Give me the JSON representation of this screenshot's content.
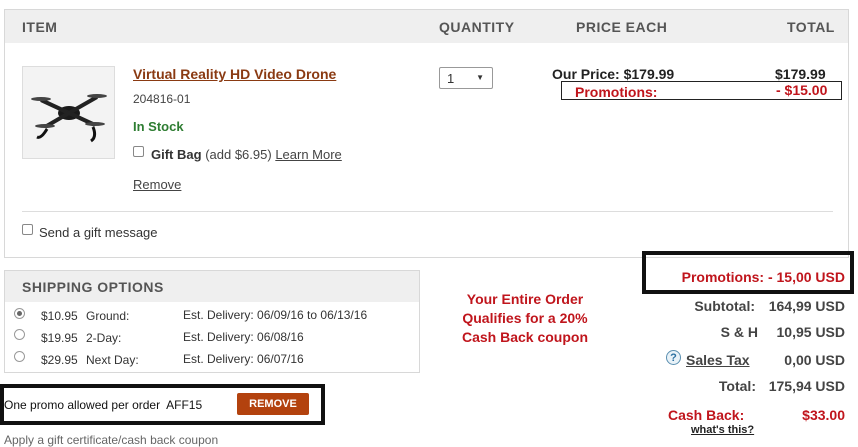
{
  "cart": {
    "headers": {
      "item": "ITEM",
      "quantity": "QUANTITY",
      "price_each": "PRICE EACH",
      "total": "TOTAL"
    },
    "item": {
      "name": "Virtual Reality HD Video Drone",
      "sku": "204816-01",
      "stock": "In Stock",
      "gift_bag_label": "Gift Bag",
      "gift_bag_price": "(add $6.95)",
      "learn_more": "Learn More",
      "remove": "Remove",
      "quantity": "1",
      "our_price_label": "Our Price:",
      "our_price": "$179.99",
      "total": "$179.99",
      "promotions_label": "Promotions:",
      "promotions_value": "- $15.00"
    },
    "gift_message_label": "Send a gift message"
  },
  "shipping": {
    "title": "SHIPPING OPTIONS",
    "options": [
      {
        "price": "$10.95",
        "name": "Ground:",
        "delivery": "Est. Delivery: 06/09/16 to 06/13/16",
        "selected": true
      },
      {
        "price": "$19.95",
        "name": "2-Day:",
        "delivery": "Est. Delivery: 06/08/16",
        "selected": false
      },
      {
        "price": "$29.95",
        "name": "Next Day:",
        "delivery": "Est. Delivery: 06/07/16",
        "selected": false
      }
    ]
  },
  "promo": {
    "text": "One promo allowed per order",
    "code": "AFF15",
    "remove_button": "REMOVE",
    "gift_cert_text": "Apply a gift certificate/cash back coupon"
  },
  "cashback_message": {
    "line1": "Your Entire Order",
    "line2": "Qualifies for a 20%",
    "line3": "Cash Back coupon"
  },
  "summary": {
    "promotions": "Promotions: - 15,00 USD",
    "subtotal_label": "Subtotal:",
    "subtotal": "164,99 USD",
    "sh_label": "S & H",
    "sh": "10,95 USD",
    "tax_label": "Sales Tax",
    "tax": "0,00 USD",
    "total_label": "Total:",
    "total": "175,94 USD",
    "cashback_label": "Cash Back:",
    "cashback": "$33.00",
    "whats_this": "what's this?"
  },
  "colors": {
    "accent": "#c0151c",
    "button": "#b3420e",
    "link": "#8a3a12",
    "stock": "#2e7d32"
  },
  "icons": {
    "help": "question-icon",
    "select": "chevron-down-icon"
  }
}
